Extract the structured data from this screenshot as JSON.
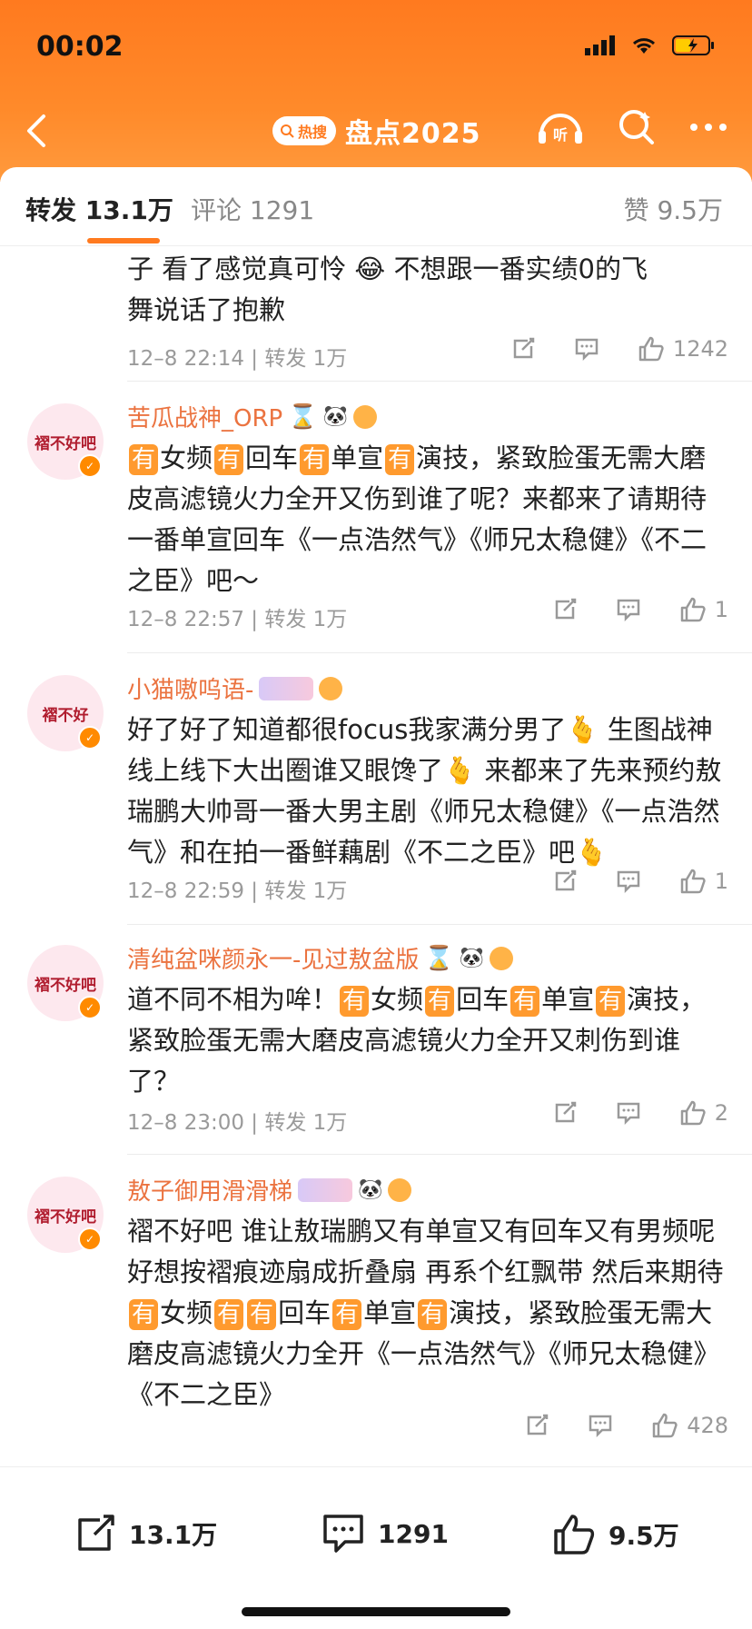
{
  "status_bar": {
    "time": "00:02"
  },
  "navbar": {
    "hot_badge": "热搜",
    "title": "盘点2025",
    "listen_label": "听"
  },
  "tabs": {
    "repost": "转发 13.1万",
    "comment": "评论 1291",
    "like": "赞 9.5万"
  },
  "items": [
    {
      "lines": [
        "子  看了感觉真可怜 😂  不想跟一番实绩0的飞",
        "舞说话了抱歉"
      ],
      "meta": "12–8 22:14 | 转发 1万",
      "likes": "1242"
    },
    {
      "avatar": "褶不好吧",
      "username": "苦瓜战神_ORP",
      "content_html": "<span class='you'>有</span>女频<span class='you'>有</span>回车<span class='you'>有</span>单宣<span class='you'>有</span>演技，紧致脸蛋无需大磨皮高滤镜火力全开又伤到谁了呢？来都来了请期待一番单宣回车《一点浩然气》《师兄太稳健》《不二之臣》吧～",
      "meta": "12–8 22:57 | 转发 1万",
      "likes": "1"
    },
    {
      "avatar": "褶不好",
      "username": "小猫嗷呜语-",
      "content": "好了好了知道都很focus我家满分男了🫰 生图战神线上线下大出圈谁又眼馋了🫰 来都来了先来预约敖瑞鹏大帅哥一番大男主剧《师兄太稳健》《一点浩然气》和在拍一番鲜藕剧《不二之臣》吧🫰",
      "meta": "12–8 22:59 | 转发 1万",
      "likes": "1"
    },
    {
      "avatar": "褶不好吧",
      "username": "清纯盆咪颜永一-见过敖盆版",
      "content_html": "道不同不相为哞！<span class='you'>有</span>女频<span class='you'>有</span>回车<span class='you'>有</span>单宣<span class='you'>有</span>演技，紧致脸蛋无需大磨皮高滤镜火力全开又刺伤到谁了？",
      "meta": "12–8 23:00 | 转发 1万",
      "likes": "2"
    },
    {
      "avatar": "褶不好吧",
      "username": "敖子御用滑滑梯",
      "content_html": "褶不好吧 谁让敖瑞鹏又有单宣又有回车又有男频呢  好想按褶痕迹扇成折叠扇 再系个红飘带 然后来期待<span class='you'>有</span>女频<span class='you'>有</span><span class='you'>有</span>回车<span class='you'>有</span>单宣<span class='you'>有</span>演技，紧致脸蛋无需大磨皮高滤镜火力全开《一点浩然气》《师兄太稳健》《不二之臣》",
      "likes": "428"
    }
  ],
  "bottom_bar": {
    "repost": "13.1万",
    "comment": "1291",
    "like": "9.5万"
  }
}
